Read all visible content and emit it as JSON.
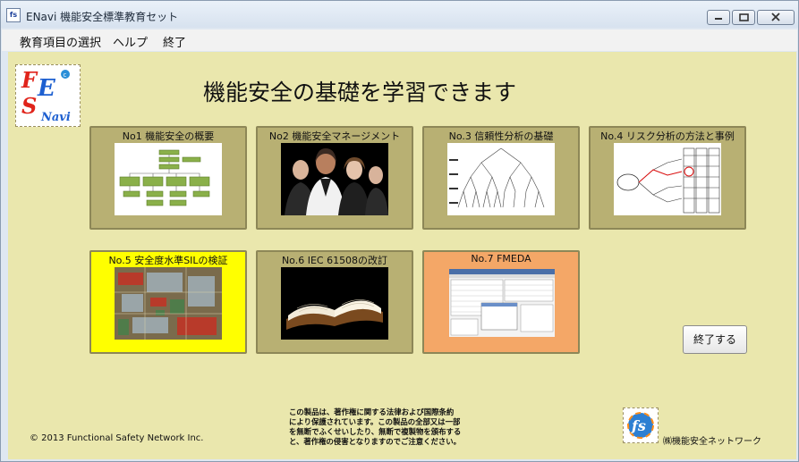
{
  "window": {
    "title": "ENavi 機能安全標準教育セット",
    "icon_text": "fs",
    "controls": {
      "minimize": "minimize-icon",
      "maximize": "maximize-icon",
      "close": "close-icon"
    }
  },
  "menu": {
    "items": [
      "教育項目の選択",
      "ヘルプ",
      "終了"
    ]
  },
  "heading": "機能安全の基礎を学習できます",
  "logo": {
    "text_f": "F",
    "text_e": "E",
    "text_s": "S",
    "text_navi": "Navi",
    "text_c": "c"
  },
  "cards": [
    {
      "label": "No1 機能安全の概要",
      "thumb": "flowchart-diagram"
    },
    {
      "label": "No2 機能安全マネージメント",
      "thumb": "business-people-photo"
    },
    {
      "label": "No.3 信頼性分析の基礎",
      "thumb": "probability-tree-diagram"
    },
    {
      "label": "No.4 リスク分析の方法と事例",
      "thumb": "risk-graph-diagram"
    },
    {
      "label": "No.5 安全度水準SILの検証",
      "thumb": "circuit-board-photo"
    },
    {
      "label": "No.6 IEC 61508の改訂",
      "thumb": "open-book-photo"
    },
    {
      "label": "No.7 FMEDA",
      "thumb": "fmeda-software-screenshot"
    }
  ],
  "exit_button": "終了する",
  "copyright": "© 2013 Functional Safety Network Inc.",
  "notice_lines": [
    "この製品は、著作権に関する法律および国際条約",
    "により保護されています。この製品の全部又は一部",
    "を無断でふくせいしたり、無断で複製物を頒布する",
    "と、著作権の侵害となりますのでご注意ください。"
  ],
  "company": "㈱機能安全ネットワーク",
  "colors": {
    "client_bg": "#eae7ad",
    "card_bg": "#b8b073",
    "card_sil": "#ffff00",
    "card_fmeda": "#f4a767"
  }
}
